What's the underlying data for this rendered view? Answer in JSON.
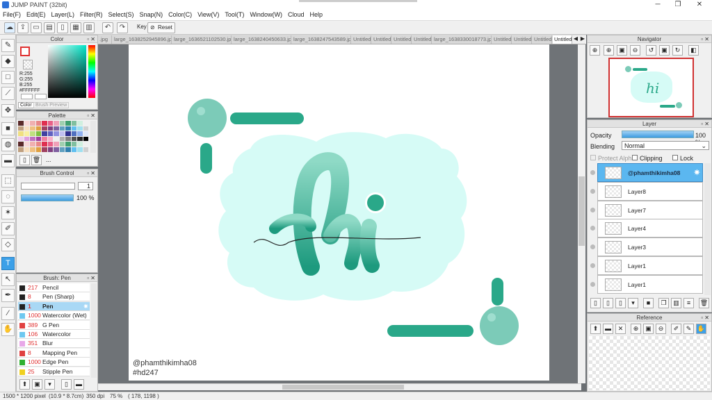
{
  "window": {
    "title": "JUMP PAINT (32bit)",
    "minimize": "─",
    "maximize": "❐",
    "close": "✕"
  },
  "menu": [
    "File(F)",
    "Edit(E)",
    "Layer(L)",
    "Filter(R)",
    "Select(S)",
    "Snap(N)",
    "Color(C)",
    "View(V)",
    "Tool(T)",
    "Window(W)",
    "Cloud",
    "Help"
  ],
  "toolbar": {
    "key_label": "Key",
    "reset_label": "Reset"
  },
  "tabs": [
    ".jpg",
    "large_1638252945896.jpg",
    "large_1636521102530.jpg",
    "large_1638240450633.jpg",
    "large_1638247543589.jpg",
    "Untitled",
    "Untitled",
    "Untitled",
    "Untitled",
    "large_1638330018773.jpg",
    "Untitled",
    "Untitled",
    "Untitled",
    "Untitled"
  ],
  "color_panel": {
    "title": "Color",
    "r": "R:255",
    "g": "G:255",
    "b": "B:255",
    "hex": "#FFFFFF",
    "tab_color": "Color",
    "tab_preview": "Brush Preview"
  },
  "palette_panel": {
    "title": "Palette",
    "more": "..."
  },
  "brush_control": {
    "title": "Brush Control",
    "size": "1",
    "opacity": "100 %"
  },
  "brush_panel": {
    "title": "Brush: Pen",
    "items": [
      {
        "num": "217",
        "label": "Pencil",
        "color": "#222222"
      },
      {
        "num": "8",
        "label": "Pen (Sharp)",
        "color": "#222222"
      },
      {
        "num": "1",
        "label": "Pen",
        "color": "#222222"
      },
      {
        "num": "1000",
        "label": "Watercolor (Wet)",
        "color": "#6fc8f0"
      },
      {
        "num": "389",
        "label": "G Pen",
        "color": "#e04040"
      },
      {
        "num": "106",
        "label": "Watercolor",
        "color": "#6fc8f0"
      },
      {
        "num": "351",
        "label": "Blur",
        "color": "#e8a8e8"
      },
      {
        "num": "8",
        "label": "Mapping Pen",
        "color": "#e04040"
      },
      {
        "num": "1000",
        "label": "Edge Pen",
        "color": "#30b030"
      },
      {
        "num": "25",
        "label": "Stipple Pen",
        "color": "#f0d020"
      }
    ]
  },
  "canvas": {
    "signature": "@phamthikimha08",
    "tag": "#hd247",
    "word": "hi"
  },
  "navigator": {
    "title": "Navigator"
  },
  "layer_panel": {
    "title": "Layer",
    "opacity_label": "Opacity",
    "opacity_value": "100 %",
    "blending_label": "Blending",
    "blending_value": "Normal",
    "protect_alpha": "Protect Alpha",
    "clipping": "Clipping",
    "lock": "Lock",
    "layers": [
      "@phamthikimha08",
      "Layer8",
      "Layer7",
      "Layer4",
      "Layer3",
      "Layer1",
      "Layer1"
    ]
  },
  "reference": {
    "title": "Reference"
  },
  "status": {
    "size": "1500 * 1200 pixel",
    "physical": "(10.9 * 8.7cm)",
    "dpi": "350 dpi",
    "zoom": "75 %",
    "coords": "( 178, 1198 )"
  },
  "colors": {
    "accent": "#2aa889",
    "light_cyan": "#d6fbf6",
    "circle": "#7ccbb8",
    "selection": "#5bb7f0"
  }
}
